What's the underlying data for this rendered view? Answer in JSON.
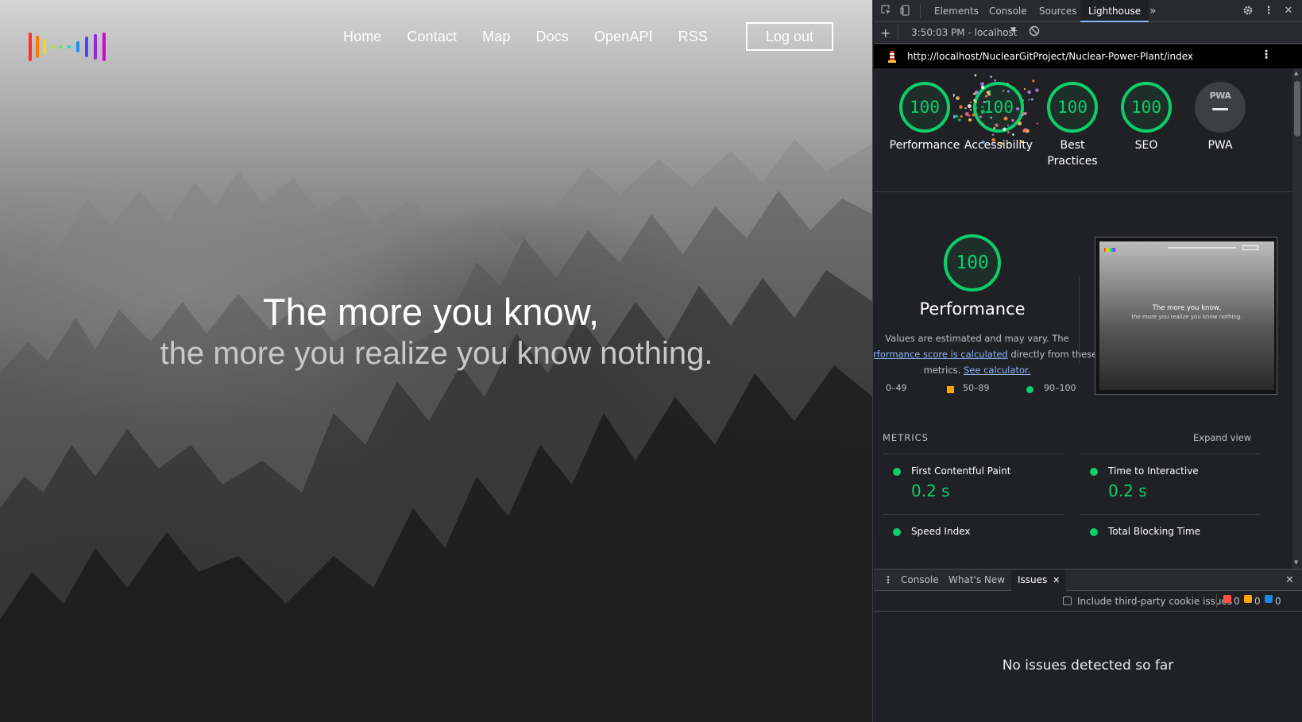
{
  "site": {
    "nav": [
      {
        "label": "Home"
      },
      {
        "label": "Contact"
      },
      {
        "label": "Map"
      },
      {
        "label": "Docs"
      },
      {
        "label": "OpenAPI"
      },
      {
        "label": "RSS"
      }
    ],
    "logout_label": "Log out",
    "hero_line1": "The more you know,",
    "hero_line2": "the more you realize you know nothing.",
    "logo_colors": [
      "#ff2a2a",
      "#ff7a00",
      "#ffd400",
      "#b6f000",
      "#3cff3c",
      "#00e0c8",
      "#1e90ff",
      "#3b4bff",
      "#8a2be2",
      "#d400d4"
    ]
  },
  "devtools": {
    "tabs": [
      "Elements",
      "Console",
      "Sources",
      "Lighthouse"
    ],
    "active_tab": "Lighthouse",
    "more_tabs_icon": "»",
    "report_time": "3:50:03 PM - localhost",
    "url": "http://localhost/NuclearGitProject/Nuclear-Power-Plant/index",
    "scores": [
      {
        "value": "100",
        "label": "Performance"
      },
      {
        "value": "100",
        "label": "Accessibility"
      },
      {
        "value": "100",
        "label": "Best\nPractices"
      },
      {
        "value": "100",
        "label": "SEO"
      },
      {
        "value": "",
        "label": "PWA"
      }
    ],
    "pwa_badge": "PWA",
    "perf": {
      "score": "100",
      "title": "Performance",
      "desc_1": "Values are estimated and may vary. The",
      "desc_link": "erformance score is calculated",
      "desc_2": " directly from these",
      "desc_3": "metrics. ",
      "calc_link": "See calculator.",
      "legend": [
        "0–49",
        "50–89",
        "90–100"
      ],
      "thumb_line1": "The more you know,",
      "thumb_line2": "the more you realize you know nothing."
    },
    "metrics_heading": "METRICS",
    "expand_label": "Expand view",
    "metrics": [
      {
        "label": "First Contentful Paint",
        "value": "0.2 s"
      },
      {
        "label": "Time to Interactive",
        "value": "0.2 s"
      },
      {
        "label": "Speed Index",
        "value": ""
      },
      {
        "label": "Total Blocking Time",
        "value": ""
      }
    ],
    "drawer_tabs": [
      "Console",
      "What's New",
      "Issues"
    ],
    "active_drawer_tab": "Issues",
    "cookie_checkbox_label": "Include third-party cookie issues",
    "issue_counts": {
      "errors": "0",
      "warnings": "0",
      "info": "0"
    },
    "no_issues_text": "No issues detected so far",
    "colors": {
      "pass": "#0cce6b",
      "average": "#ffa400",
      "fail": "#ff4e42",
      "link": "#8ab4f8"
    }
  }
}
